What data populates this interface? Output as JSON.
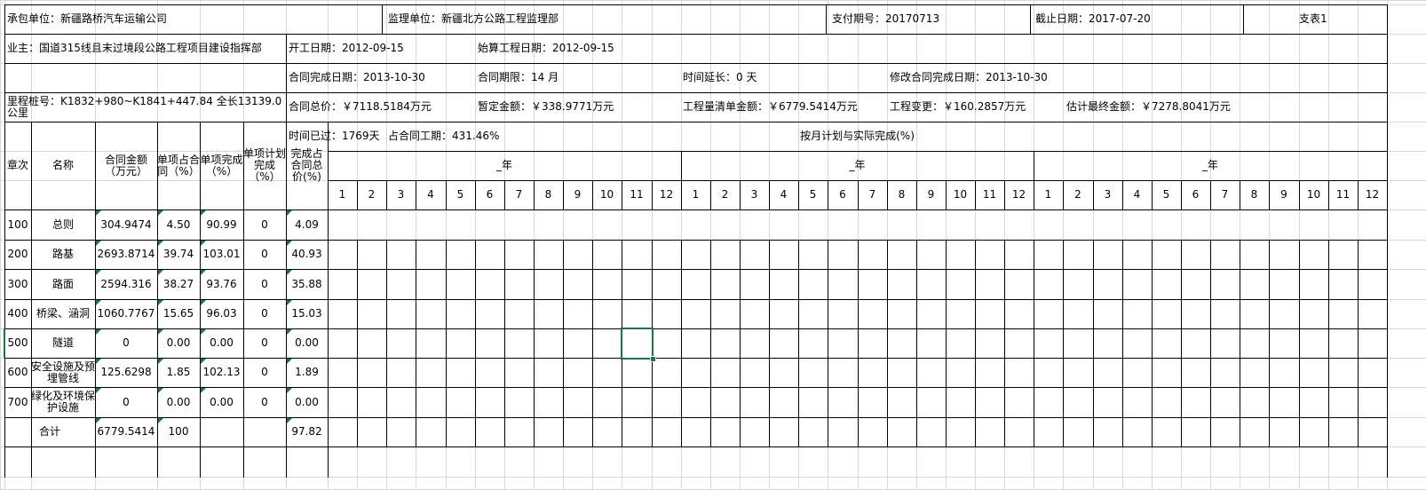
{
  "info": {
    "contractor": "承包单位：新疆路桥汽车运输公司",
    "supervisor": "监理单位：新疆北方公路工程监理部",
    "payment_no": "支付期号：20170713",
    "deadline": "截止日期：2017-07-20",
    "sheet_id": "支表1",
    "owner": "业主：国道315线且末过境段公路工程项目建设指挥部",
    "start_date": "开工日期：2012-09-15",
    "calc_start": "始算工程日期：2012-09-15",
    "contract_finish": "合同完成日期：2013-10-30",
    "contract_period": "合同期限：14 月",
    "extension": "时间延长：0 天",
    "revised_finish": "修改合同完成日期：2013-10-30",
    "stake": "里程桩号：K1832+980~K1841+447.84  全长13139.0公里",
    "contract_total": "合同总价：￥7118.5184万元",
    "provisional": "暂定金额：￥338.9771万元",
    "boq_amount": "工程量清单金额：￥6779.5414万元",
    "variation": "工程变更：￥160.2857万元",
    "estimate_final": "估计最终金额：￥7278.8041万元",
    "elapsed": "时间已过：1769天",
    "elapsed_pct": "占合同工期：431.46%"
  },
  "headers": {
    "chapter": "章次",
    "name": "名称",
    "amount": "合同金额（万元）",
    "share": "单项占合同（%）",
    "done": "单项完成（%）",
    "plan": "单项计划完成（%）",
    "total_pct": "完成占合同总价(%)",
    "monthly": "按月计划与实际完成(%)",
    "year": "_年",
    "months": [
      "1",
      "2",
      "3",
      "4",
      "5",
      "6",
      "7",
      "8",
      "9",
      "10",
      "11",
      "12"
    ]
  },
  "rows": [
    {
      "chapter": "100",
      "name": "总则",
      "amount": "304.9474",
      "share": "4.50",
      "done": "90.99",
      "plan": "0",
      "total": "4.09"
    },
    {
      "chapter": "200",
      "name": "路基",
      "amount": "2693.8714",
      "share": "39.74",
      "done": "103.01",
      "plan": "0",
      "total": "40.93"
    },
    {
      "chapter": "300",
      "name": "路面",
      "amount": "2594.316",
      "share": "38.27",
      "done": "93.76",
      "plan": "0",
      "total": "35.88"
    },
    {
      "chapter": "400",
      "name": "桥梁、涵洞",
      "amount": "1060.7767",
      "share": "15.65",
      "done": "96.03",
      "plan": "0",
      "total": "15.03"
    },
    {
      "chapter": "500",
      "name": "隧道",
      "amount": "0",
      "share": "0.00",
      "done": "0.00",
      "plan": "0",
      "total": "0.00"
    },
    {
      "chapter": "600",
      "name": "安全设施及预埋管线",
      "amount": "125.6298",
      "share": "1.85",
      "done": "102.13",
      "plan": "0",
      "total": "1.89"
    },
    {
      "chapter": "700",
      "name": "绿化及环境保护设施",
      "amount": "0",
      "share": "0.00",
      "done": "0.00",
      "plan": "0",
      "total": "0.00"
    }
  ],
  "total_row": {
    "label": "合计",
    "amount": "6779.5414",
    "share": "100",
    "done": "",
    "plan": "",
    "total": "97.82"
  }
}
